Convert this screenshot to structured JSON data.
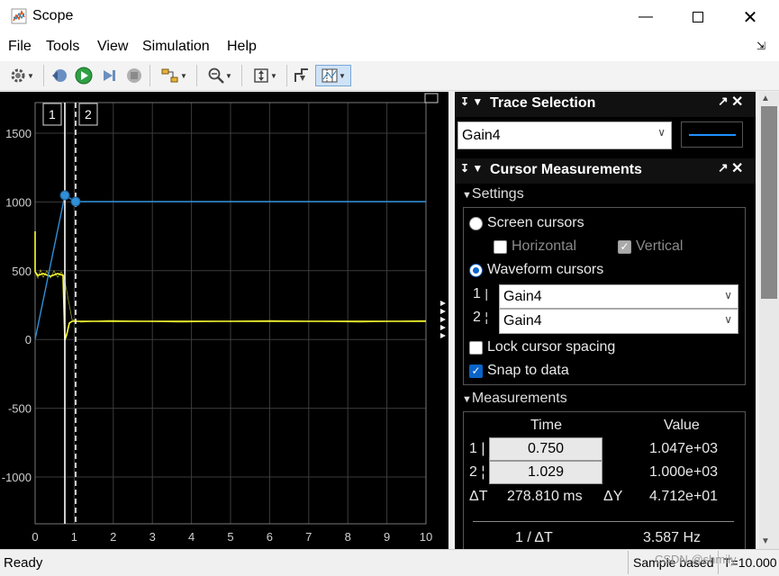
{
  "window": {
    "title": "Scope"
  },
  "menu": [
    "File",
    "Tools",
    "View",
    "Simulation",
    "Help"
  ],
  "toolbar_icons": [
    "gear-icon",
    "step-back-icon",
    "run-icon",
    "step-forward-icon",
    "stop-icon",
    "highlight-icon",
    "zoom-icon",
    "scale-axes-icon",
    "measurement-icon",
    "cursor-measurement-icon"
  ],
  "plot": {
    "y_ticks": [
      "1500",
      "1000",
      "500",
      "0",
      "-500",
      "-1000"
    ],
    "x_ticks": [
      "0",
      "1",
      "2",
      "3",
      "4",
      "5",
      "6",
      "7",
      "8",
      "9",
      "10"
    ],
    "cursor_labels": [
      "1",
      "2"
    ],
    "colors": {
      "blue": "#2f8fd8",
      "yellow": "#ffff33",
      "grid": "#3c3c3c"
    }
  },
  "trace_selection": {
    "title": "Trace Selection",
    "selected": "Gain4",
    "line_color": "#1e90ff"
  },
  "cursor_measurements": {
    "title": "Cursor Measurements",
    "settings_label": "Settings",
    "screen_cursors": "Screen cursors",
    "horizontal": "Horizontal",
    "vertical": "Vertical",
    "waveform_cursors": "Waveform cursors",
    "cursor1_label": "1",
    "cursor2_label": "2",
    "cursor1_signal": "Gain4",
    "cursor2_signal": "Gain4",
    "lock_spacing": "Lock cursor spacing",
    "snap_to_data": "Snap to data",
    "measurements_label": "Measurements",
    "col_time": "Time",
    "col_value": "Value",
    "row1_label": "1",
    "row1_time": "0.750",
    "row1_value": "1.047e+03",
    "row2_label": "2",
    "row2_time": "1.029",
    "row2_value": "1.000e+03",
    "delta_t_label": "ΔT",
    "delta_t_value": "278.810 ms",
    "delta_y_label": "ΔY",
    "delta_y_value": "4.712e+01",
    "inv_dt_label": "1 / ΔT",
    "inv_dt_value": "3.587 Hz"
  },
  "status": {
    "left": "Ready",
    "middle": "Sample based",
    "right": "T=10.000",
    "watermark": "CSDN @shmily"
  }
}
